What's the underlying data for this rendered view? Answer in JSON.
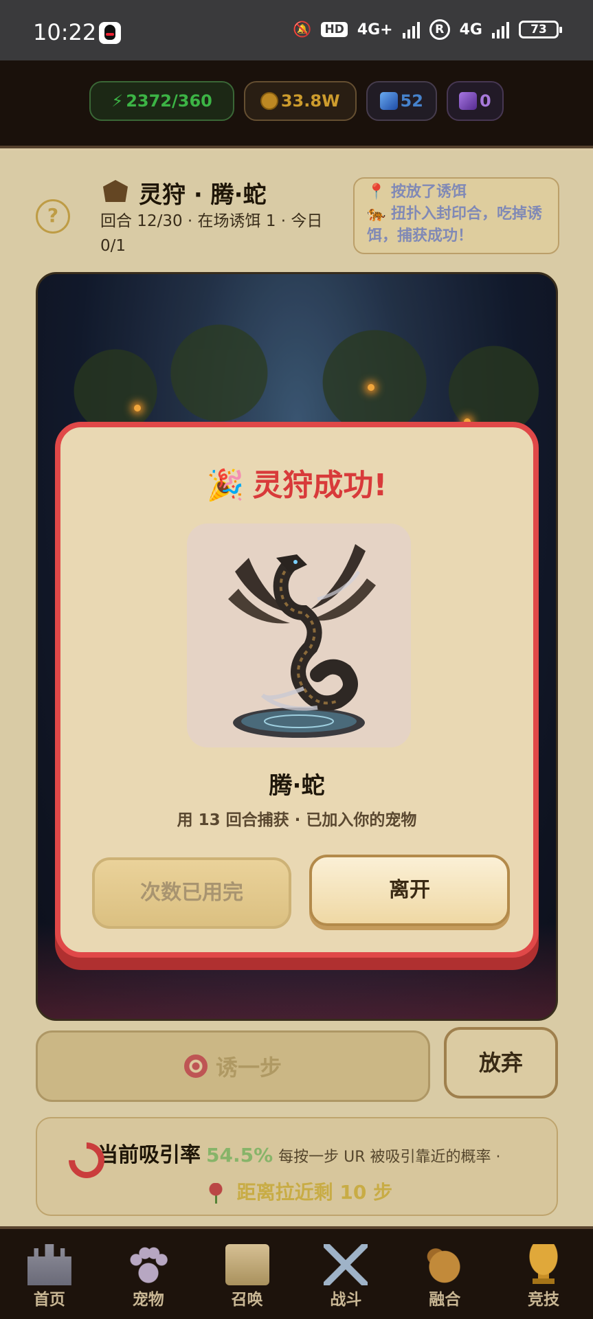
{
  "status_bar": {
    "time": "10:22",
    "hd_label": "HD",
    "net1_label": "4G+",
    "net2_label": "4G",
    "r_label": "R",
    "battery": "73"
  },
  "resources": {
    "energy": "2372/360",
    "coins": "33.8W",
    "gems": "52",
    "cubes": "0"
  },
  "hunt": {
    "title": "灵狩 · 腾·蛇",
    "subtitle": "回合 12/30 · 在场诱饵 1 · 今日 0/1",
    "help_label": "?",
    "log_line1": "📍 按放了诱饵",
    "log_line2": "🐅 扭扑入封印合，吃掉诱饵，捕获成功！"
  },
  "actions": {
    "lure_label": "诱一步",
    "giveup_label": "放弃"
  },
  "attract": {
    "label": "当前吸引率",
    "rate": "54.5%",
    "desc": "每按一步 UR 被吸引靠近的概率 ·",
    "distance": "距离拉近剩 10 步"
  },
  "modal": {
    "title": "灵狩成功!",
    "pet_name": "腾·蛇",
    "pet_desc": "用 13 回合捕获 · 已加入你的宠物",
    "used_label": "次数已用完",
    "leave_label": "离开"
  },
  "nav": {
    "items": [
      {
        "label": "首页",
        "icon": "castle-icon"
      },
      {
        "label": "宠物",
        "icon": "paw-icon"
      },
      {
        "label": "召唤",
        "icon": "scroll-icon"
      },
      {
        "label": "战斗",
        "icon": "swords-icon"
      },
      {
        "label": "融合",
        "icon": "dragon-icon"
      },
      {
        "label": "竞技",
        "icon": "trophy-icon"
      }
    ]
  },
  "colors": {
    "modal_border": "#e04848",
    "modal_title": "#d83a3a",
    "energy": "#3fbf4a",
    "coin": "#d9a530",
    "gem": "#4a8ad9",
    "cube": "#b180e8"
  }
}
